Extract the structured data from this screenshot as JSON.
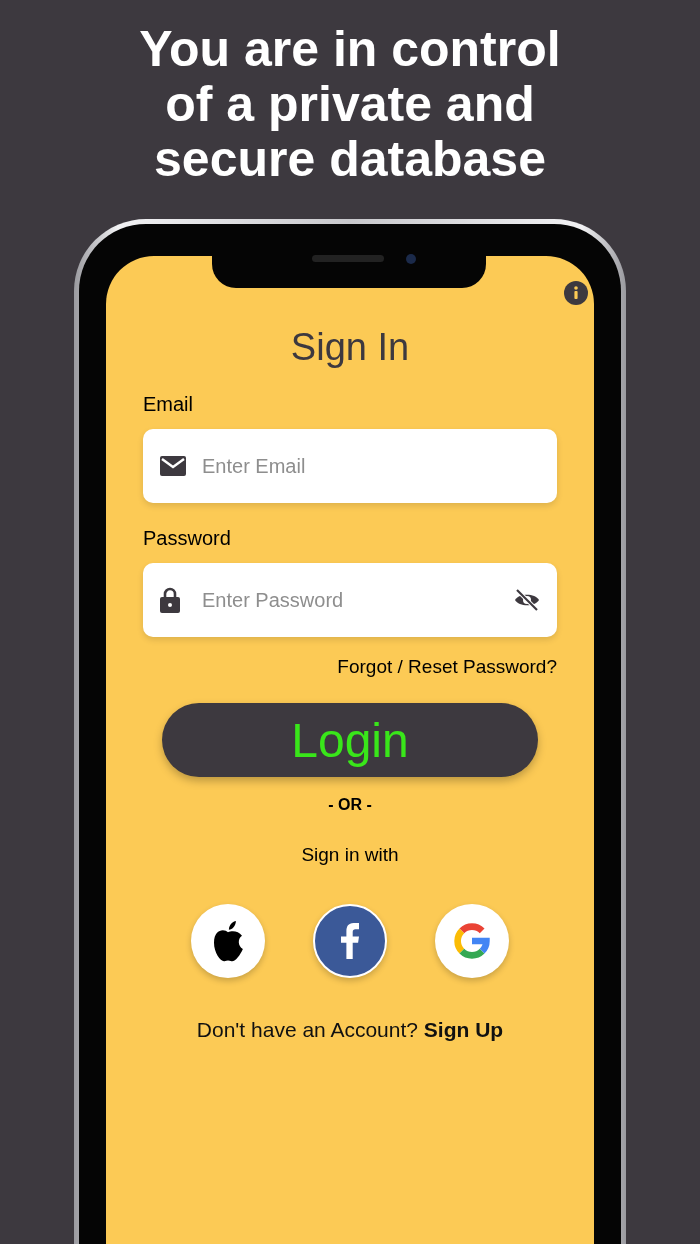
{
  "headline": "You are in control of a private and secure database",
  "screen": {
    "title": "Sign In",
    "fields": [
      {
        "kind": "email",
        "label": "Email",
        "placeholder": "Enter Email"
      },
      {
        "kind": "password",
        "label": "Password",
        "placeholder": "Enter Password"
      }
    ],
    "forgot_link": "Forgot / Reset Password?",
    "login_button": "Login",
    "divider": "- OR -",
    "social_prompt": "Sign in with",
    "social": [
      {
        "kind": "apple"
      },
      {
        "kind": "facebook"
      },
      {
        "kind": "google"
      }
    ],
    "signup_prompt": "Don't have an Account?",
    "signup_link": "Sign Up"
  }
}
